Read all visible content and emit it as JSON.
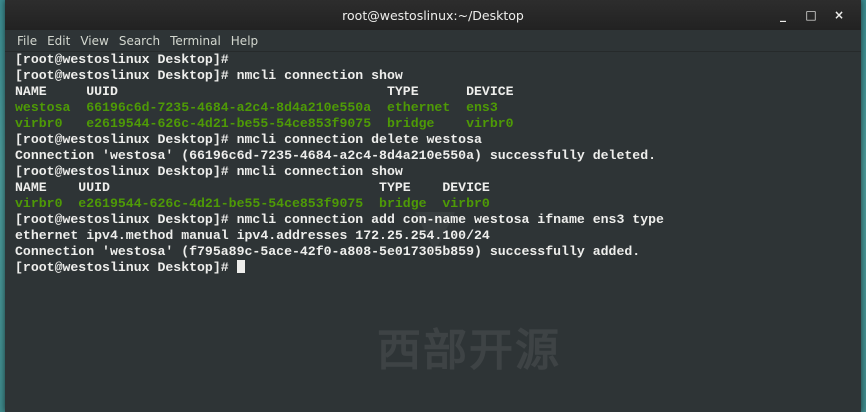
{
  "window": {
    "title": "root@westoslinux:~/Desktop"
  },
  "controls": {
    "minimize": "_",
    "maximize": "□",
    "close": "×"
  },
  "menu": [
    "File",
    "Edit",
    "View",
    "Search",
    "Terminal",
    "Help"
  ],
  "terminal": {
    "lines": [
      {
        "text": "[root@westoslinux Desktop]#",
        "style": "prompt"
      },
      {
        "text": "[root@westoslinux Desktop]# nmcli connection show",
        "style": "prompt"
      },
      {
        "text": "NAME     UUID                                  TYPE      DEVICE",
        "style": "header"
      },
      {
        "text": "westosa  66196c6d-7235-4684-a2c4-8d4a210e550a  ethernet  ens3",
        "style": "green"
      },
      {
        "text": "virbr0   e2619544-626c-4d21-be55-54ce853f9075  bridge    virbr0",
        "style": "green"
      },
      {
        "text": "[root@westoslinux Desktop]# nmcli connection delete westosa",
        "style": "prompt"
      },
      {
        "text": "Connection 'westosa' (66196c6d-7235-4684-a2c4-8d4a210e550a) successfully deleted.",
        "style": "output"
      },
      {
        "text": "[root@westoslinux Desktop]# nmcli connection show",
        "style": "prompt"
      },
      {
        "text": "NAME    UUID                                  TYPE    DEVICE",
        "style": "header"
      },
      {
        "text": "virbr0  e2619544-626c-4d21-be55-54ce853f9075  bridge  virbr0",
        "style": "green"
      },
      {
        "text": "[root@westoslinux Desktop]# nmcli connection add con-name westosa ifname ens3 type",
        "style": "prompt"
      },
      {
        "text": "ethernet ipv4.method manual ipv4.addresses 172.25.254.100/24",
        "style": "output"
      },
      {
        "text": "Connection 'westosa' (f795a89c-5ace-42f0-a808-5e017305b859) successfully added.",
        "style": "output"
      },
      {
        "text": "[root@westoslinux Desktop]# ",
        "style": "prompt-cursor"
      }
    ]
  },
  "watermark": "西部开源",
  "colors": {
    "terminal_bg": "#2e3436",
    "green": "#4e9a06",
    "text": "#eeeeec"
  }
}
